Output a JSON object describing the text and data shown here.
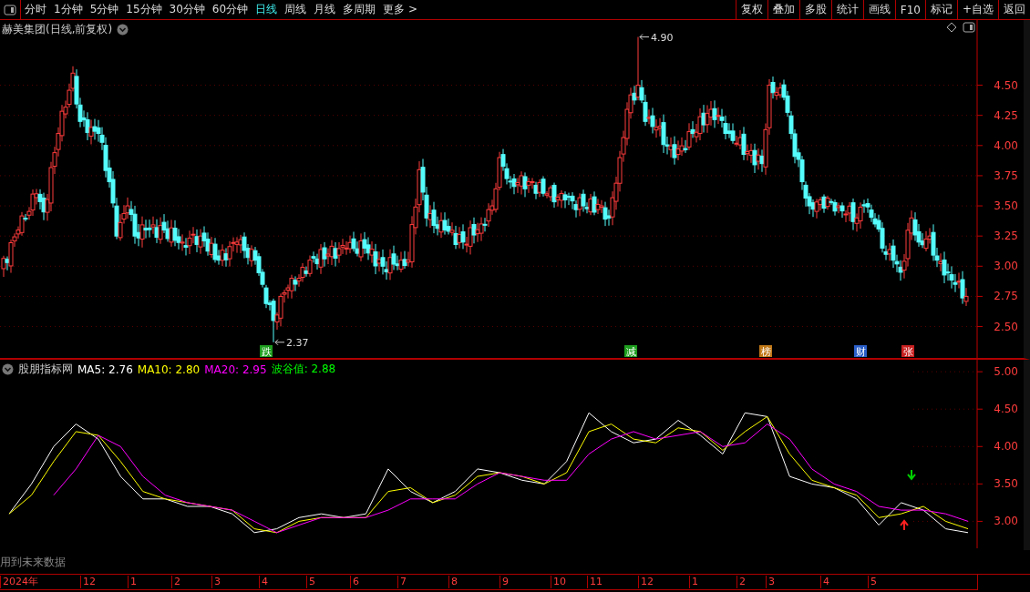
{
  "toolbar": {
    "periods": [
      {
        "label": "分时",
        "selected": false
      },
      {
        "label": "1分钟",
        "selected": false
      },
      {
        "label": "5分钟",
        "selected": false
      },
      {
        "label": "15分钟",
        "selected": false
      },
      {
        "label": "30分钟",
        "selected": false
      },
      {
        "label": "60分钟",
        "selected": false
      },
      {
        "label": "日线",
        "selected": true
      },
      {
        "label": "周线",
        "selected": false
      },
      {
        "label": "月线",
        "selected": false
      },
      {
        "label": "多周期",
        "selected": false
      },
      {
        "label": "更多 >",
        "selected": false
      }
    ],
    "buttons": [
      "复权",
      "叠加",
      "多股",
      "统计",
      "画线",
      "F10",
      "标记",
      "+自选",
      "返回"
    ]
  },
  "main": {
    "title": "赫美集团(日线,前复权)",
    "price_axis": [
      "4.50",
      "4.25",
      "4.00",
      "3.75",
      "3.50",
      "3.25",
      "3.00",
      "2.75",
      "2.50"
    ],
    "high_label": "4.90",
    "low_label": "2.37",
    "events": [
      {
        "label": "跌",
        "color": "#1e9e1e"
      },
      {
        "label": "减",
        "color": "#1e9e1e"
      },
      {
        "label": "榜",
        "color": "#c07818"
      },
      {
        "label": "财",
        "color": "#2a5ec8"
      },
      {
        "label": "张",
        "color": "#c82020"
      }
    ]
  },
  "indicator": {
    "name": "股朋指标网",
    "legend": [
      {
        "text": "MA5: 2.76",
        "color": "#ffffff"
      },
      {
        "text": "MA10: 2.80",
        "color": "#ffff00"
      },
      {
        "text": "MA20: 2.95",
        "color": "#ff00ff"
      },
      {
        "text": "波谷值: 2.88",
        "color": "#00ff00"
      }
    ],
    "value_axis": [
      "5.00",
      "4.50",
      "4.00",
      "3.50",
      "3.00"
    ],
    "signals": [
      {
        "kind": "sell"
      },
      {
        "kind": "buy"
      }
    ]
  },
  "note": "用到未来数据",
  "date_axis": [
    "2024年",
    "12",
    "1",
    "2",
    "3",
    "4",
    "5",
    "6",
    "7",
    "8",
    "9",
    "10",
    "11",
    "12",
    "1",
    "2",
    "3",
    "4",
    "5"
  ]
}
